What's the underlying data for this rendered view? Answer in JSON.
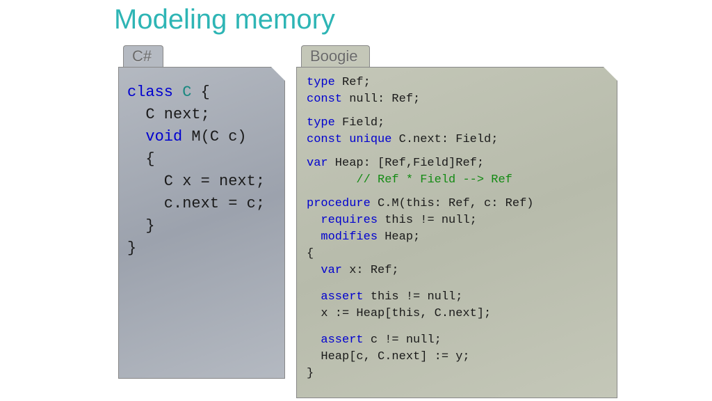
{
  "title": "Modeling memory",
  "panels": {
    "cs": {
      "label": "C#",
      "code": [
        {
          "frags": [
            {
              "t": "class ",
              "c": "kw-blue"
            },
            {
              "t": "C",
              "c": "kw-teal"
            },
            {
              "t": " {"
            }
          ]
        },
        {
          "frags": [
            {
              "t": "  C next;"
            }
          ]
        },
        {
          "frags": [
            {
              "t": "  "
            },
            {
              "t": "void",
              "c": "kw-blue"
            },
            {
              "t": " M(C c)"
            }
          ]
        },
        {
          "frags": [
            {
              "t": "  {"
            }
          ]
        },
        {
          "frags": [
            {
              "t": "    C x = next;"
            }
          ]
        },
        {
          "frags": [
            {
              "t": "    c.next = c;"
            }
          ]
        },
        {
          "frags": [
            {
              "t": "  }"
            }
          ]
        },
        {
          "frags": [
            {
              "t": "}"
            }
          ]
        }
      ]
    },
    "boogie": {
      "label": "Boogie",
      "code": [
        {
          "frags": [
            {
              "t": "type",
              "c": "kw-blue"
            },
            {
              "t": " Ref;"
            }
          ]
        },
        {
          "frags": [
            {
              "t": "const",
              "c": "kw-blue"
            },
            {
              "t": " null: Ref;"
            }
          ]
        },
        {
          "gap": 10
        },
        {
          "frags": [
            {
              "t": "type",
              "c": "kw-blue"
            },
            {
              "t": " Field;"
            }
          ]
        },
        {
          "frags": [
            {
              "t": "const unique",
              "c": "kw-blue"
            },
            {
              "t": " C.next: Field;"
            }
          ]
        },
        {
          "gap": 10
        },
        {
          "frags": [
            {
              "t": "var",
              "c": "kw-blue"
            },
            {
              "t": " Heap: [Ref,Field]Ref;"
            }
          ]
        },
        {
          "frags": [
            {
              "t": "       "
            },
            {
              "t": "// Ref * Field --> Ref",
              "c": "kw-green"
            }
          ]
        },
        {
          "gap": 10
        },
        {
          "frags": [
            {
              "t": "procedure",
              "c": "kw-blue"
            },
            {
              "t": " C.M(this: Ref, c: Ref)"
            }
          ]
        },
        {
          "frags": [
            {
              "t": "  "
            },
            {
              "t": "requires",
              "c": "kw-blue"
            },
            {
              "t": " this != null;"
            }
          ]
        },
        {
          "frags": [
            {
              "t": "  "
            },
            {
              "t": "modifies",
              "c": "kw-blue"
            },
            {
              "t": " Heap;"
            }
          ]
        },
        {
          "frags": [
            {
              "t": "{"
            }
          ]
        },
        {
          "frags": [
            {
              "t": "  "
            },
            {
              "t": "var",
              "c": "kw-blue"
            },
            {
              "t": " x: Ref;"
            }
          ]
        },
        {
          "gap": 14
        },
        {
          "frags": [
            {
              "t": "  "
            },
            {
              "t": "assert",
              "c": "kw-blue"
            },
            {
              "t": " this != null;"
            }
          ]
        },
        {
          "frags": [
            {
              "t": "  x := Heap[this, C.next];"
            }
          ]
        },
        {
          "gap": 14
        },
        {
          "frags": [
            {
              "t": "  "
            },
            {
              "t": "assert",
              "c": "kw-blue"
            },
            {
              "t": " c != null;"
            }
          ]
        },
        {
          "frags": [
            {
              "t": "  Heap[c, C.next] := y;"
            }
          ]
        },
        {
          "frags": [
            {
              "t": "}"
            }
          ]
        }
      ]
    }
  }
}
